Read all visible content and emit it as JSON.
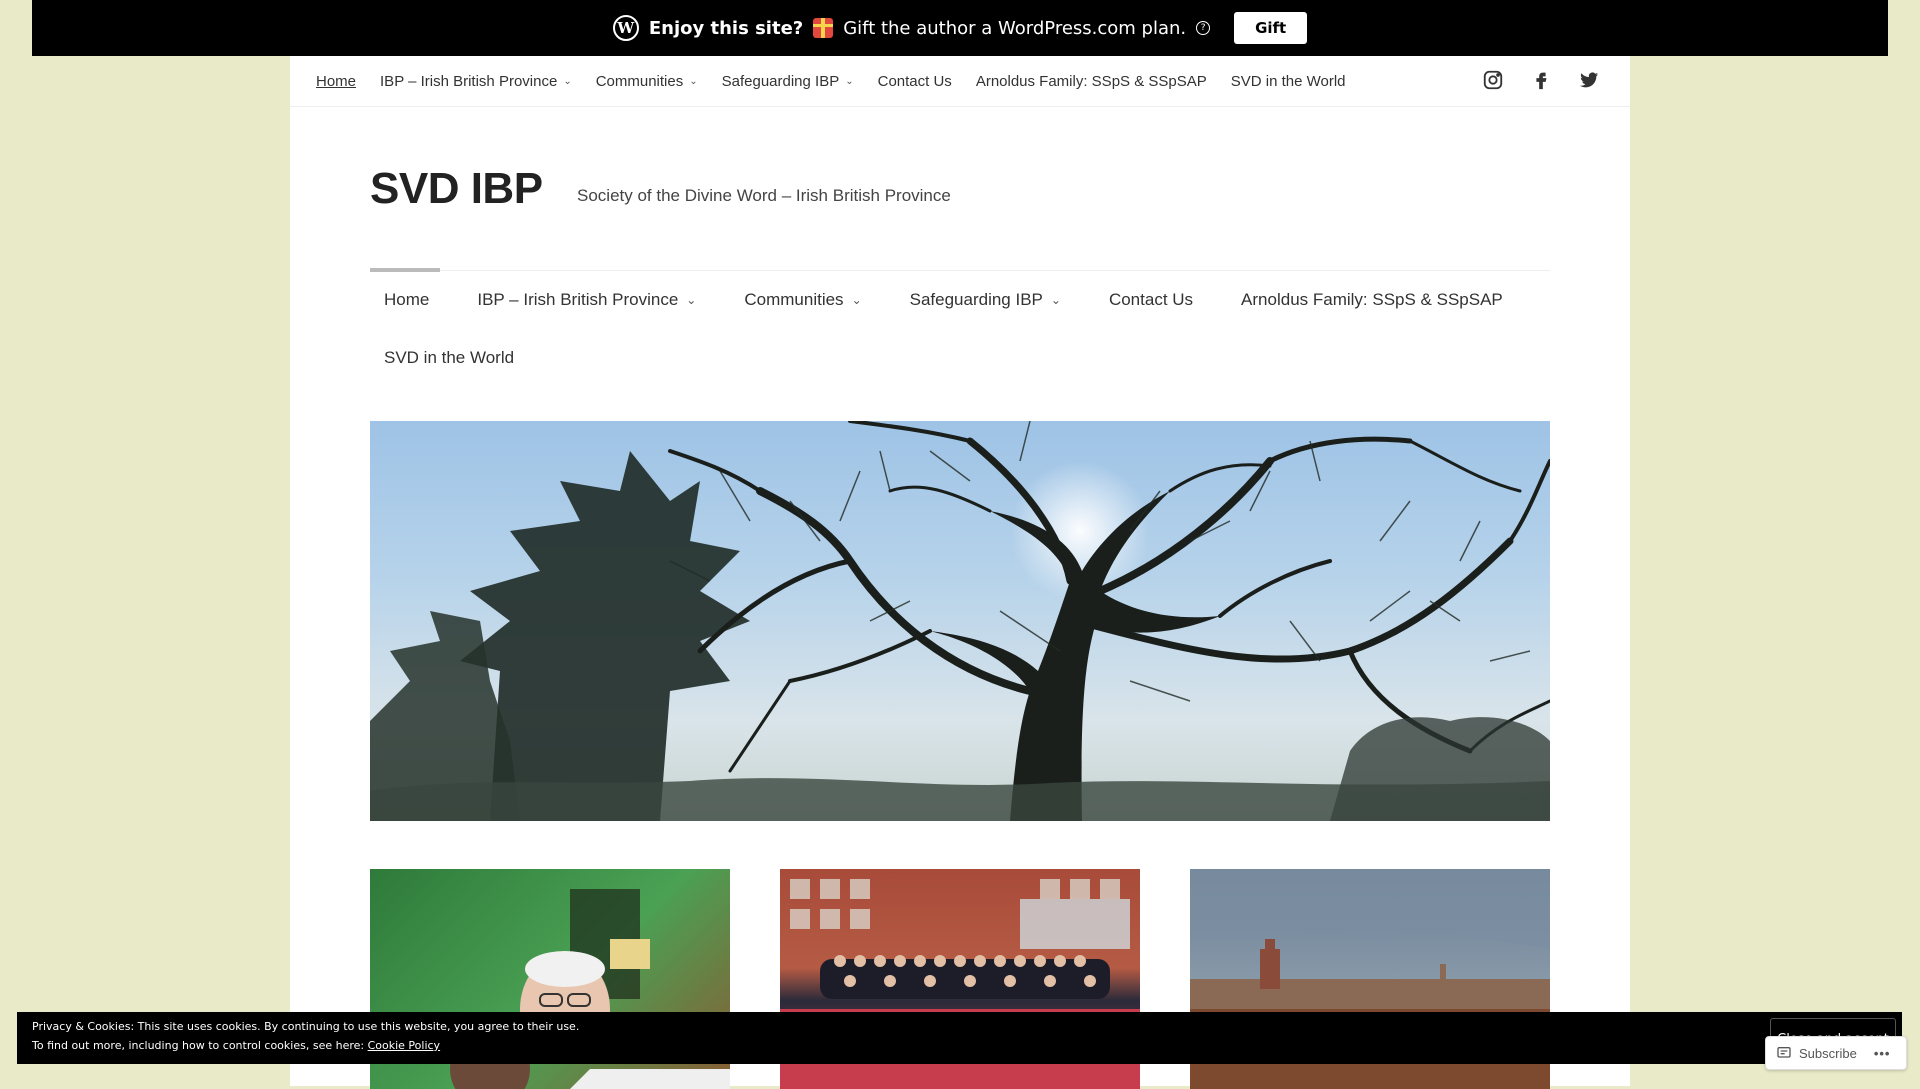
{
  "promo": {
    "enjoy": "Enjoy this site?",
    "message": "Gift the author a WordPress.com plan.",
    "gift_button": "Gift",
    "wp_logo": "W",
    "help": "?"
  },
  "top_nav": {
    "items": [
      {
        "label": "Home"
      },
      {
        "label": "IBP – Irish British Province"
      },
      {
        "label": "Communities"
      },
      {
        "label": "Safeguarding IBP"
      },
      {
        "label": "Contact Us"
      },
      {
        "label": "Arnoldus Family: SSpS & SSpSAP"
      },
      {
        "label": "SVD in the World"
      }
    ],
    "chevron": "⌄"
  },
  "site": {
    "title": "SVD IBP",
    "tagline": "Society of the Divine Word – Irish British Province"
  },
  "main_nav": {
    "items": [
      {
        "label": "Home"
      },
      {
        "label": "IBP – Irish British Province"
      },
      {
        "label": "Communities"
      },
      {
        "label": "Safeguarding IBP"
      },
      {
        "label": "Contact Us"
      },
      {
        "label": "Arnoldus Family: SSpS & SSpSAP"
      },
      {
        "label": "SVD in the World"
      }
    ],
    "chevron": "⌄"
  },
  "cookie": {
    "line1": "Privacy & Cookies: This site uses cookies. By continuing to use this website, you agree to their use.",
    "line2_prefix": "To find out more, including how to control cookies, see here:",
    "line2_link": "Cookie Policy",
    "close_button": "Close and accept"
  },
  "subscribe": {
    "label": "Subscribe",
    "more": "•••"
  },
  "colors": {
    "page_bg": "#e9ebc8",
    "bar_bg": "#000000"
  }
}
